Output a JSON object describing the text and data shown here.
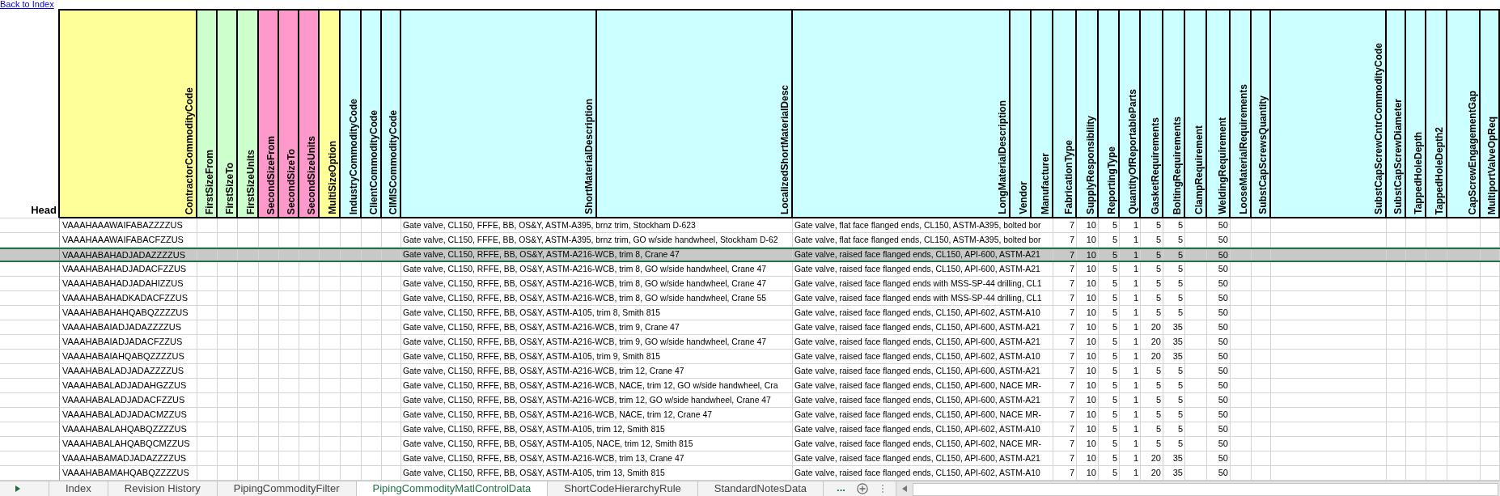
{
  "link": {
    "text": "Back to Index"
  },
  "header": {
    "corner_label": "Head"
  },
  "columns": [
    {
      "name": "ContractorCommodityCode",
      "color": "#ffff99"
    },
    {
      "name": "FirstSizeFrom",
      "color": "#ccffcc"
    },
    {
      "name": "FirstSizeTo",
      "color": "#ccffcc"
    },
    {
      "name": "FirstSizeUnits",
      "color": "#ccffcc"
    },
    {
      "name": "SecondSizeFrom",
      "color": "#ff99cc"
    },
    {
      "name": "SecondSizeTo",
      "color": "#ff99cc"
    },
    {
      "name": "SecondSizeUnits",
      "color": "#ff99cc"
    },
    {
      "name": "MultiSizeOption",
      "color": "#ffff99"
    },
    {
      "name": "IndustryCommodityCode",
      "color": "#ccffff"
    },
    {
      "name": "ClientCommodityCode",
      "color": "#ccffff"
    },
    {
      "name": "CIMISCommodityCode",
      "color": "#ccffff"
    },
    {
      "name": "ShortMaterialDescription",
      "color": "#ccffff"
    },
    {
      "name": "LocalizedShortMaterialDesc",
      "color": "#ccffff"
    },
    {
      "name": "LongMaterialDescription",
      "color": "#ccffff"
    },
    {
      "name": "Vendor",
      "color": "#ccffff"
    },
    {
      "name": "Manufacturer",
      "color": "#ccffff"
    },
    {
      "name": "FabricationType",
      "color": "#ccffff"
    },
    {
      "name": "SupplyResponsibility",
      "color": "#ccffff"
    },
    {
      "name": "ReportingType",
      "color": "#ccffff"
    },
    {
      "name": "QuantityOfReportableParts",
      "color": "#ccffff"
    },
    {
      "name": "GasketRequirements",
      "color": "#ccffff"
    },
    {
      "name": "BoltingRequirements",
      "color": "#ccffff"
    },
    {
      "name": "ClampRequirement",
      "color": "#ccffff"
    },
    {
      "name": "WeldingRequirement",
      "color": "#ccffff"
    },
    {
      "name": "LooseMaterialRequirements",
      "color": "#ccffff"
    },
    {
      "name": "SubstCapScrewsQuantity",
      "color": "#ccffff"
    },
    {
      "name": "SubstCapScrewCntrCommodityCode",
      "color": "#ccffff"
    },
    {
      "name": "SubstCapScrewDiameter",
      "color": "#ccffff"
    },
    {
      "name": "TappedHoleDepth",
      "color": "#ccffff"
    },
    {
      "name": "TappedHoleDepth2",
      "color": "#ccffff"
    },
    {
      "name": "CapScrewEngagementGap",
      "color": "#ccffff"
    },
    {
      "name": "MultiportValveOpReq",
      "color": "#ccffff"
    }
  ],
  "rows": [
    {
      "selected": false,
      "code": "VAAAHAAAWAIFABAZZZZUS",
      "short_description": "Gate valve, CL150, FFFE, BB, OS&Y, ASTM-A395, brnz trim, Stockham D-623",
      "long_description": "Gate valve, flat face flanged ends, CL150, ASTM-A395, bolted bor",
      "fabrication_type": "7",
      "supply_responsibility": "10",
      "reporting_type": "5",
      "quantity_of_reportable_parts": "1",
      "gasket_requirements": "5",
      "bolting_requirements": "5",
      "welding_requirement": "50"
    },
    {
      "selected": false,
      "code": "VAAAHAAAWAIFABACFZZUS",
      "short_description": "Gate valve, CL150, FFFE, BB, OS&Y, ASTM-A395, brnz trim, GO w/side handwheel, Stockham D-62",
      "long_description": "Gate valve, flat face flanged ends, CL150, ASTM-A395, bolted bor",
      "fabrication_type": "7",
      "supply_responsibility": "10",
      "reporting_type": "5",
      "quantity_of_reportable_parts": "1",
      "gasket_requirements": "5",
      "bolting_requirements": "5",
      "welding_requirement": "50"
    },
    {
      "selected": true,
      "code": "VAAAHABAHADJADAZZZZUS",
      "short_description": "Gate valve, CL150, RFFE, BB, OS&Y, ASTM-A216-WCB, trim 8, Crane 47",
      "long_description": "Gate valve, raised face flanged ends, CL150, API-600, ASTM-A21",
      "fabrication_type": "7",
      "supply_responsibility": "10",
      "reporting_type": "5",
      "quantity_of_reportable_parts": "1",
      "gasket_requirements": "5",
      "bolting_requirements": "5",
      "welding_requirement": "50"
    },
    {
      "selected": false,
      "code": "VAAAHABAHADJADACFZZUS",
      "short_description": "Gate valve, CL150, RFFE, BB, OS&Y, ASTM-A216-WCB, trim 8, GO w/side handwheel, Crane 47",
      "long_description": "Gate valve, raised face flanged ends, CL150, API-600, ASTM-A21",
      "fabrication_type": "7",
      "supply_responsibility": "10",
      "reporting_type": "5",
      "quantity_of_reportable_parts": "1",
      "gasket_requirements": "5",
      "bolting_requirements": "5",
      "welding_requirement": "50"
    },
    {
      "selected": false,
      "code": "VAAAHABAHADJADAHIZZUS",
      "short_description": "Gate valve, CL150, RFFE, BB, OS&Y, ASTM-A216-WCB, trim 8, GO w/side handwheel, Crane 47",
      "long_description": "Gate valve, raised face flanged ends with MSS-SP-44 drilling, CL1",
      "fabrication_type": "7",
      "supply_responsibility": "10",
      "reporting_type": "5",
      "quantity_of_reportable_parts": "1",
      "gasket_requirements": "5",
      "bolting_requirements": "5",
      "welding_requirement": "50"
    },
    {
      "selected": false,
      "code": "VAAAHABAHADKADACFZZUS",
      "short_description": "Gate valve, CL150, RFFE, BB, OS&Y, ASTM-A216-WCB, trim 8, GO w/side handwheel, Crane 55",
      "long_description": "Gate valve, raised face flanged ends with MSS-SP-44 drilling, CL1",
      "fabrication_type": "7",
      "supply_responsibility": "10",
      "reporting_type": "5",
      "quantity_of_reportable_parts": "1",
      "gasket_requirements": "5",
      "bolting_requirements": "5",
      "welding_requirement": "50"
    },
    {
      "selected": false,
      "code": "VAAAHABAHAHQABQZZZZUS",
      "short_description": "Gate valve, CL150, RFFE, BB, OS&Y, ASTM-A105, trim 8, Smith 815",
      "long_description": "Gate valve, raised face flanged ends, CL150, API-602, ASTM-A10",
      "fabrication_type": "7",
      "supply_responsibility": "10",
      "reporting_type": "5",
      "quantity_of_reportable_parts": "1",
      "gasket_requirements": "5",
      "bolting_requirements": "5",
      "welding_requirement": "50"
    },
    {
      "selected": false,
      "code": "VAAAHABAIADJADAZZZZUS",
      "short_description": "Gate valve, CL150, RFFE, BB, OS&Y, ASTM-A216-WCB, trim 9, Crane 47",
      "long_description": "Gate valve, raised face flanged ends, CL150, API-600, ASTM-A21",
      "fabrication_type": "7",
      "supply_responsibility": "10",
      "reporting_type": "5",
      "quantity_of_reportable_parts": "1",
      "gasket_requirements": "20",
      "bolting_requirements": "35",
      "welding_requirement": "50"
    },
    {
      "selected": false,
      "code": "VAAAHABAIADJADACFZZUS",
      "short_description": "Gate valve, CL150, RFFE, BB, OS&Y, ASTM-A216-WCB, trim 9, GO w/side handwheel, Crane 47",
      "long_description": "Gate valve, raised face flanged ends, CL150, API-600, ASTM-A21",
      "fabrication_type": "7",
      "supply_responsibility": "10",
      "reporting_type": "5",
      "quantity_of_reportable_parts": "1",
      "gasket_requirements": "20",
      "bolting_requirements": "35",
      "welding_requirement": "50"
    },
    {
      "selected": false,
      "code": "VAAAHABAIAHQABQZZZZUS",
      "short_description": "Gate valve, CL150, RFFE, BB, OS&Y, ASTM-A105, trim 9, Smith 815",
      "long_description": "Gate valve, raised face flanged ends, CL150, API-602, ASTM-A10",
      "fabrication_type": "7",
      "supply_responsibility": "10",
      "reporting_type": "5",
      "quantity_of_reportable_parts": "1",
      "gasket_requirements": "20",
      "bolting_requirements": "35",
      "welding_requirement": "50"
    },
    {
      "selected": false,
      "code": "VAAAHABALADJADAZZZZUS",
      "short_description": "Gate valve, CL150, RFFE, BB, OS&Y, ASTM-A216-WCB, trim 12, Crane 47",
      "long_description": "Gate valve, raised face flanged ends, CL150, API-600, ASTM-A21",
      "fabrication_type": "7",
      "supply_responsibility": "10",
      "reporting_type": "5",
      "quantity_of_reportable_parts": "1",
      "gasket_requirements": "5",
      "bolting_requirements": "5",
      "welding_requirement": "50"
    },
    {
      "selected": false,
      "code": "VAAAHABALADJADAHGZZUS",
      "short_description": "Gate valve, CL150, RFFE, BB, OS&Y, ASTM-A216-WCB, NACE, trim 12, GO w/side handwheel, Cra",
      "long_description": "Gate valve, raised face flanged ends, CL150, API-600, NACE MR-",
      "fabrication_type": "7",
      "supply_responsibility": "10",
      "reporting_type": "5",
      "quantity_of_reportable_parts": "1",
      "gasket_requirements": "5",
      "bolting_requirements": "5",
      "welding_requirement": "50"
    },
    {
      "selected": false,
      "code": "VAAAHABALADJADACFZZUS",
      "short_description": "Gate valve, CL150, RFFE, BB, OS&Y, ASTM-A216-WCB, trim 12, GO w/side handwheel, Crane 47",
      "long_description": "Gate valve, raised face flanged ends, CL150, API-600, ASTM-A21",
      "fabrication_type": "7",
      "supply_responsibility": "10",
      "reporting_type": "5",
      "quantity_of_reportable_parts": "1",
      "gasket_requirements": "5",
      "bolting_requirements": "5",
      "welding_requirement": "50"
    },
    {
      "selected": false,
      "code": "VAAAHABALADJADACMZZUS",
      "short_description": "Gate valve, CL150, RFFE, BB, OS&Y, ASTM-A216-WCB, NACE, trim 12, Crane 47",
      "long_description": "Gate valve, raised face flanged ends, CL150, API-600, NACE MR-",
      "fabrication_type": "7",
      "supply_responsibility": "10",
      "reporting_type": "5",
      "quantity_of_reportable_parts": "1",
      "gasket_requirements": "5",
      "bolting_requirements": "5",
      "welding_requirement": "50"
    },
    {
      "selected": false,
      "code": "VAAAHABALAHQABQZZZZUS",
      "short_description": "Gate valve, CL150, RFFE, BB, OS&Y, ASTM-A105, trim 12, Smith 815",
      "long_description": "Gate valve, raised face flanged ends, CL150, API-602, ASTM-A10",
      "fabrication_type": "7",
      "supply_responsibility": "10",
      "reporting_type": "5",
      "quantity_of_reportable_parts": "1",
      "gasket_requirements": "5",
      "bolting_requirements": "5",
      "welding_requirement": "50"
    },
    {
      "selected": false,
      "code": "VAAAHABALAHQABQCMZZUS",
      "short_description": "Gate valve, CL150, RFFE, BB, OS&Y, ASTM-A105, NACE, trim 12, Smith 815",
      "long_description": "Gate valve, raised face flanged ends, CL150, API-602, NACE MR-",
      "fabrication_type": "7",
      "supply_responsibility": "10",
      "reporting_type": "5",
      "quantity_of_reportable_parts": "1",
      "gasket_requirements": "5",
      "bolting_requirements": "5",
      "welding_requirement": "50"
    },
    {
      "selected": false,
      "code": "VAAAHABAMADJADAZZZZUS",
      "short_description": "Gate valve, CL150, RFFE, BB, OS&Y, ASTM-A216-WCB, trim 13, Crane 47",
      "long_description": "Gate valve, raised face flanged ends, CL150, API-600, ASTM-A21",
      "fabrication_type": "7",
      "supply_responsibility": "10",
      "reporting_type": "5",
      "quantity_of_reportable_parts": "1",
      "gasket_requirements": "20",
      "bolting_requirements": "35",
      "welding_requirement": "50"
    },
    {
      "selected": false,
      "code": "VAAAHABAMAHQABQZZZZUS",
      "short_description": "Gate valve, CL150, RFFE, BB, OS&Y, ASTM-A105, trim 13, Smith 815",
      "long_description": "Gate valve, raised face flanged ends, CL150, API-602, ASTM-A10",
      "fabrication_type": "7",
      "supply_responsibility": "10",
      "reporting_type": "5",
      "quantity_of_reportable_parts": "1",
      "gasket_requirements": "20",
      "bolting_requirements": "35",
      "welding_requirement": "50"
    }
  ],
  "sheet_tabs": [
    {
      "label": "Index",
      "selected": false
    },
    {
      "label": "Revision History",
      "selected": false
    },
    {
      "label": "PipingCommodityFilter",
      "selected": false
    },
    {
      "label": "PipingCommodityMatlControlData",
      "selected": true
    },
    {
      "label": "ShortCodeHierarchyRule",
      "selected": false
    },
    {
      "label": "StandardNotesData",
      "selected": false
    }
  ],
  "more_tabs": "..."
}
